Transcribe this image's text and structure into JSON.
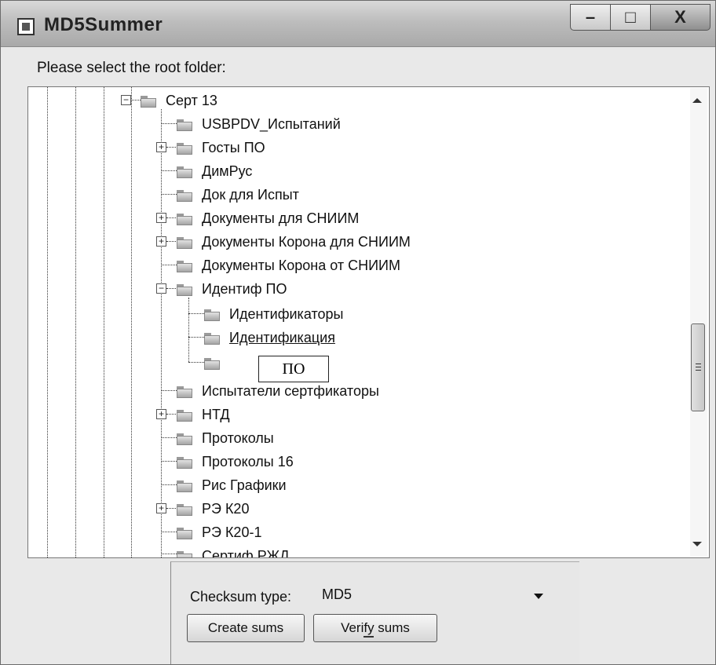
{
  "window": {
    "title": "MD5Summer",
    "minimize_glyph": "–",
    "maximize_glyph": "□",
    "close_glyph": "X"
  },
  "prompt": "Please select the root folder:",
  "tree": {
    "root": {
      "label": "Серт 13",
      "expanded": true
    },
    "items": [
      {
        "label": "USBPDV_Испытаний",
        "expander": ""
      },
      {
        "label": "Госты ПО",
        "expander": "+"
      },
      {
        "label": "ДимРус",
        "expander": ""
      },
      {
        "label": "Док для Испыт",
        "expander": ""
      },
      {
        "label": "Документы для СНИИМ",
        "expander": "+"
      },
      {
        "label": "Документы Корона для СНИИМ",
        "expander": "+"
      },
      {
        "label": "Документы Корона от СНИИМ",
        "expander": ""
      },
      {
        "label": "Идентиф ПО",
        "expander": "−",
        "children": [
          {
            "label": "Идентификаторы"
          },
          {
            "label": "Идентификация"
          },
          {
            "label": "ПО",
            "editing": true
          }
        ]
      },
      {
        "label": "Испытатели сертфикаторы",
        "expander": ""
      },
      {
        "label": "НТД",
        "expander": "+"
      },
      {
        "label": "Протоколы",
        "expander": ""
      },
      {
        "label": "Протоколы 16",
        "expander": ""
      },
      {
        "label": "Рис Графики",
        "expander": ""
      },
      {
        "label": "РЭ К20",
        "expander": "+"
      },
      {
        "label": "РЭ К20-1",
        "expander": ""
      },
      {
        "label": "Сертиф РЖД",
        "expander": ""
      }
    ]
  },
  "checksum": {
    "label": "Checksum type:",
    "value": "MD5"
  },
  "buttons": {
    "create": "Create sums",
    "verify": "Verify sums"
  },
  "icons": [
    "app-icon",
    "folder-icon",
    "expander-plus-icon",
    "expander-minus-icon",
    "scroll-up-arrow-icon",
    "scroll-down-arrow-icon",
    "dropdown-arrow-icon"
  ]
}
